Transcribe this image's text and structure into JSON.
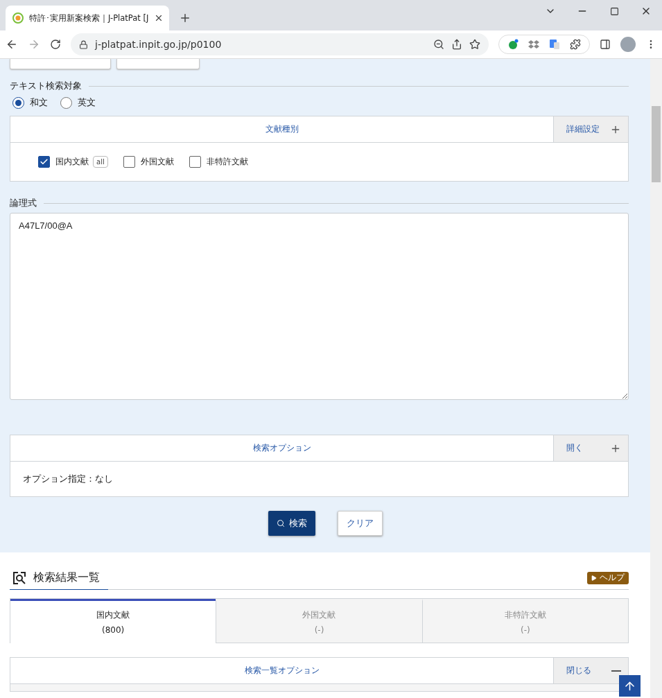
{
  "browser": {
    "tab_title": "特許･実用新案検索｜J-PlatPat [J",
    "address": "j-platpat.inpit.go.jp/p0100"
  },
  "text_target": {
    "label": "テキスト検索対象",
    "options": [
      {
        "label": "和文",
        "selected": true
      },
      {
        "label": "英文",
        "selected": false
      }
    ]
  },
  "doc_type": {
    "title": "文献種別",
    "toggle": "詳細設定",
    "expanded": false,
    "items": [
      {
        "label": "国内文献",
        "checked": true,
        "badge": "all"
      },
      {
        "label": "外国文献",
        "checked": false
      },
      {
        "label": "非特許文献",
        "checked": false
      }
    ]
  },
  "formula": {
    "label": "論理式",
    "value": "A47L7/00@A"
  },
  "search_options": {
    "title": "検索オプション",
    "toggle": "開く",
    "expanded": false,
    "summary": "オプション指定：なし"
  },
  "buttons": [
    {
      "kind": "primary",
      "label": "検索"
    },
    {
      "kind": "secondary",
      "label": "クリア"
    }
  ],
  "results": {
    "title": "検索結果一覧",
    "help": "ヘルプ",
    "tabs": [
      {
        "label": "国内文献",
        "count": "(800)",
        "selected": true
      },
      {
        "label": "外国文献",
        "count": "(-)",
        "selected": false
      },
      {
        "label": "非特許文献",
        "count": "(-)",
        "selected": false
      }
    ],
    "list_options": {
      "title": "検索一覧オプション",
      "toggle": "閉じる",
      "expanded": true
    }
  }
}
